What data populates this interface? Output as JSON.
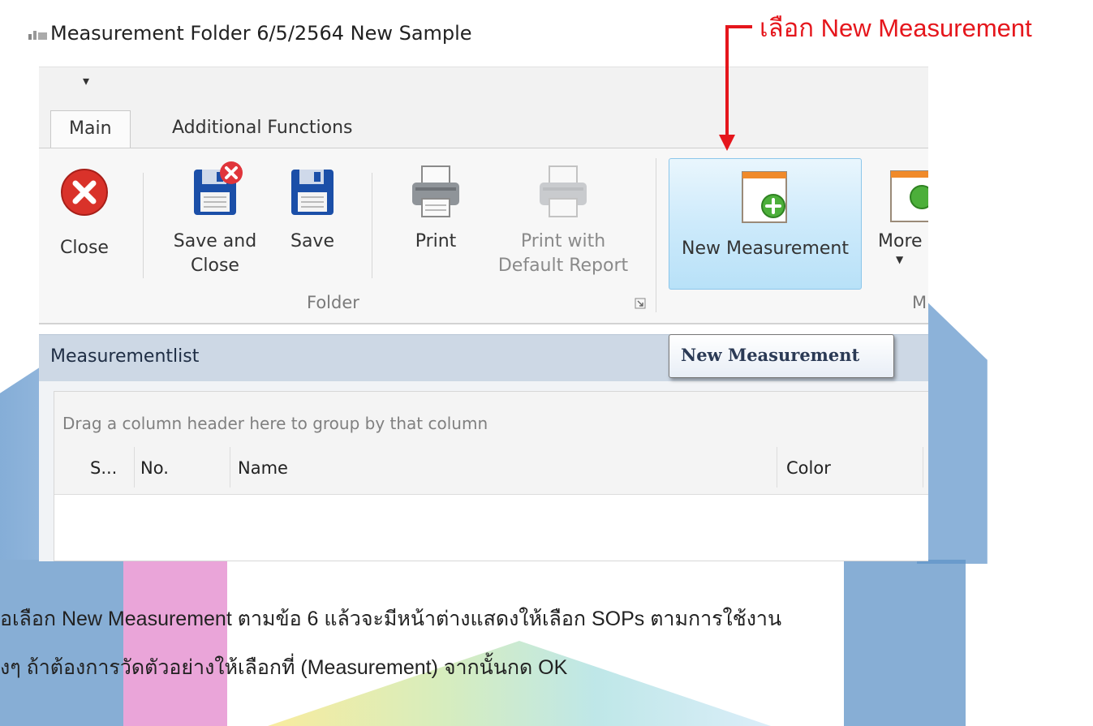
{
  "window": {
    "title": "Measurement Folder 6/5/2564 New Sample"
  },
  "qat": {
    "dropdown_glyph": "▾"
  },
  "tabs": [
    {
      "label": "Main",
      "active": true
    },
    {
      "label": "Additional Functions",
      "active": false
    }
  ],
  "ribbon": {
    "close_label": "Close",
    "save_close_label_line1": "Save and",
    "save_close_label_line2": "Close",
    "save_label": "Save",
    "print_label": "Print",
    "print_default_line1": "Print with",
    "print_default_line2": "Default Report",
    "folder_group_label": "Folder",
    "new_measurement_label": "New Measurement",
    "more_label": "More",
    "cut_group_label": "M"
  },
  "tooltip": {
    "text": "New Measurement"
  },
  "panel": {
    "title": "Measurementlist",
    "group_hint": "Drag a column header here to group by that column",
    "columns": [
      "S...",
      "No.",
      "Name",
      "Color"
    ]
  },
  "annotation": {
    "label": "เลือก New Measurement",
    "color": "#e5161c"
  },
  "instructions": {
    "line1": "อเลือก New Measurement ตามข้อ 6 แล้วจะมีหน้าต่างแสดงให้เลือก SOPs ตามการใช้งาน",
    "line2": "งๆ ถ้าต้องการวัดตัวอย่างให้เลือกที่ (Measurement) จากนั้นกด OK"
  },
  "icons": [
    "app-icon",
    "close-icon",
    "save-close-icon",
    "save-icon",
    "print-icon",
    "print-default-icon",
    "new-measurement-icon",
    "more-icon",
    "dialog-launcher-icon"
  ]
}
